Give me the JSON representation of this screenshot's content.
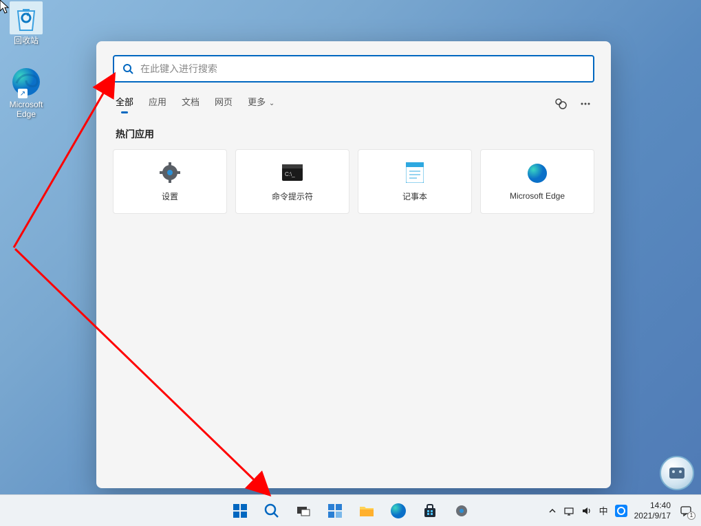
{
  "desktop": {
    "recycle_bin_label": "回收站",
    "edge_label": "Microsoft Edge"
  },
  "search": {
    "placeholder": "在此键入进行搜索",
    "tabs": {
      "all": "全部",
      "apps": "应用",
      "documents": "文档",
      "web": "网页",
      "more": "更多"
    },
    "section_top_apps": "热门应用",
    "apps": {
      "settings": "设置",
      "cmd": "命令提示符",
      "notepad": "记事本",
      "edge": "Microsoft Edge"
    }
  },
  "taskbar": {
    "ime_text": "中",
    "time": "14:40",
    "date": "2021/9/17",
    "notif_count": "1"
  }
}
